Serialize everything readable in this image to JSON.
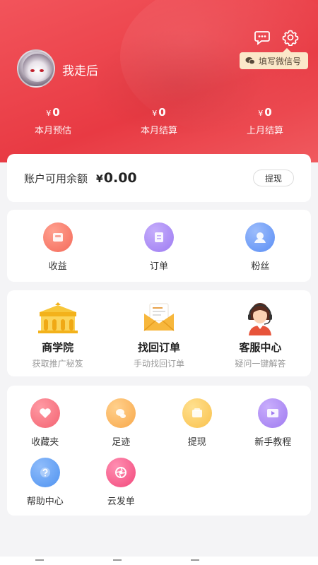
{
  "header": {
    "username": "我走后",
    "wechat_tag": "填写微信号",
    "message_icon": "message-icon",
    "settings_icon": "gear-icon"
  },
  "stats": [
    {
      "currency": "¥",
      "value": "0",
      "label": "本月预估"
    },
    {
      "currency": "¥",
      "value": "0",
      "label": "本月结算"
    },
    {
      "currency": "¥",
      "value": "0",
      "label": "上月结算"
    }
  ],
  "balance": {
    "label": "账户可用余额",
    "currency": "¥",
    "amount": "0.00",
    "withdraw_label": "提现"
  },
  "main_menu": [
    {
      "label": "收益",
      "icon": "earnings-icon",
      "color": "#f46a5a"
    },
    {
      "label": "订单",
      "icon": "order-icon",
      "color": "#9d7bf2"
    },
    {
      "label": "粉丝",
      "icon": "fans-icon",
      "color": "#5a8ef5"
    }
  ],
  "promo": [
    {
      "title": "商学院",
      "sub": "获取推广秘笈",
      "icon": "academy-icon"
    },
    {
      "title": "找回订单",
      "sub": "手动找回订单",
      "icon": "envelope-icon"
    },
    {
      "title": "客服中心",
      "sub": "疑问一键解答",
      "icon": "customer-service-icon"
    }
  ],
  "tools": [
    {
      "label": "收藏夹",
      "icon": "heart-icon",
      "color": "#f36371"
    },
    {
      "label": "足迹",
      "icon": "footprint-icon",
      "color": "#f8a84a"
    },
    {
      "label": "提现",
      "icon": "wallet-icon",
      "color": "#f9c14c"
    },
    {
      "label": "新手教程",
      "icon": "video-icon",
      "color": "#9f7af0"
    },
    {
      "label": "帮助中心",
      "icon": "help-icon",
      "color": "#4f93f0"
    },
    {
      "label": "云发单",
      "icon": "aperture-icon",
      "color": "#f2487b"
    }
  ]
}
